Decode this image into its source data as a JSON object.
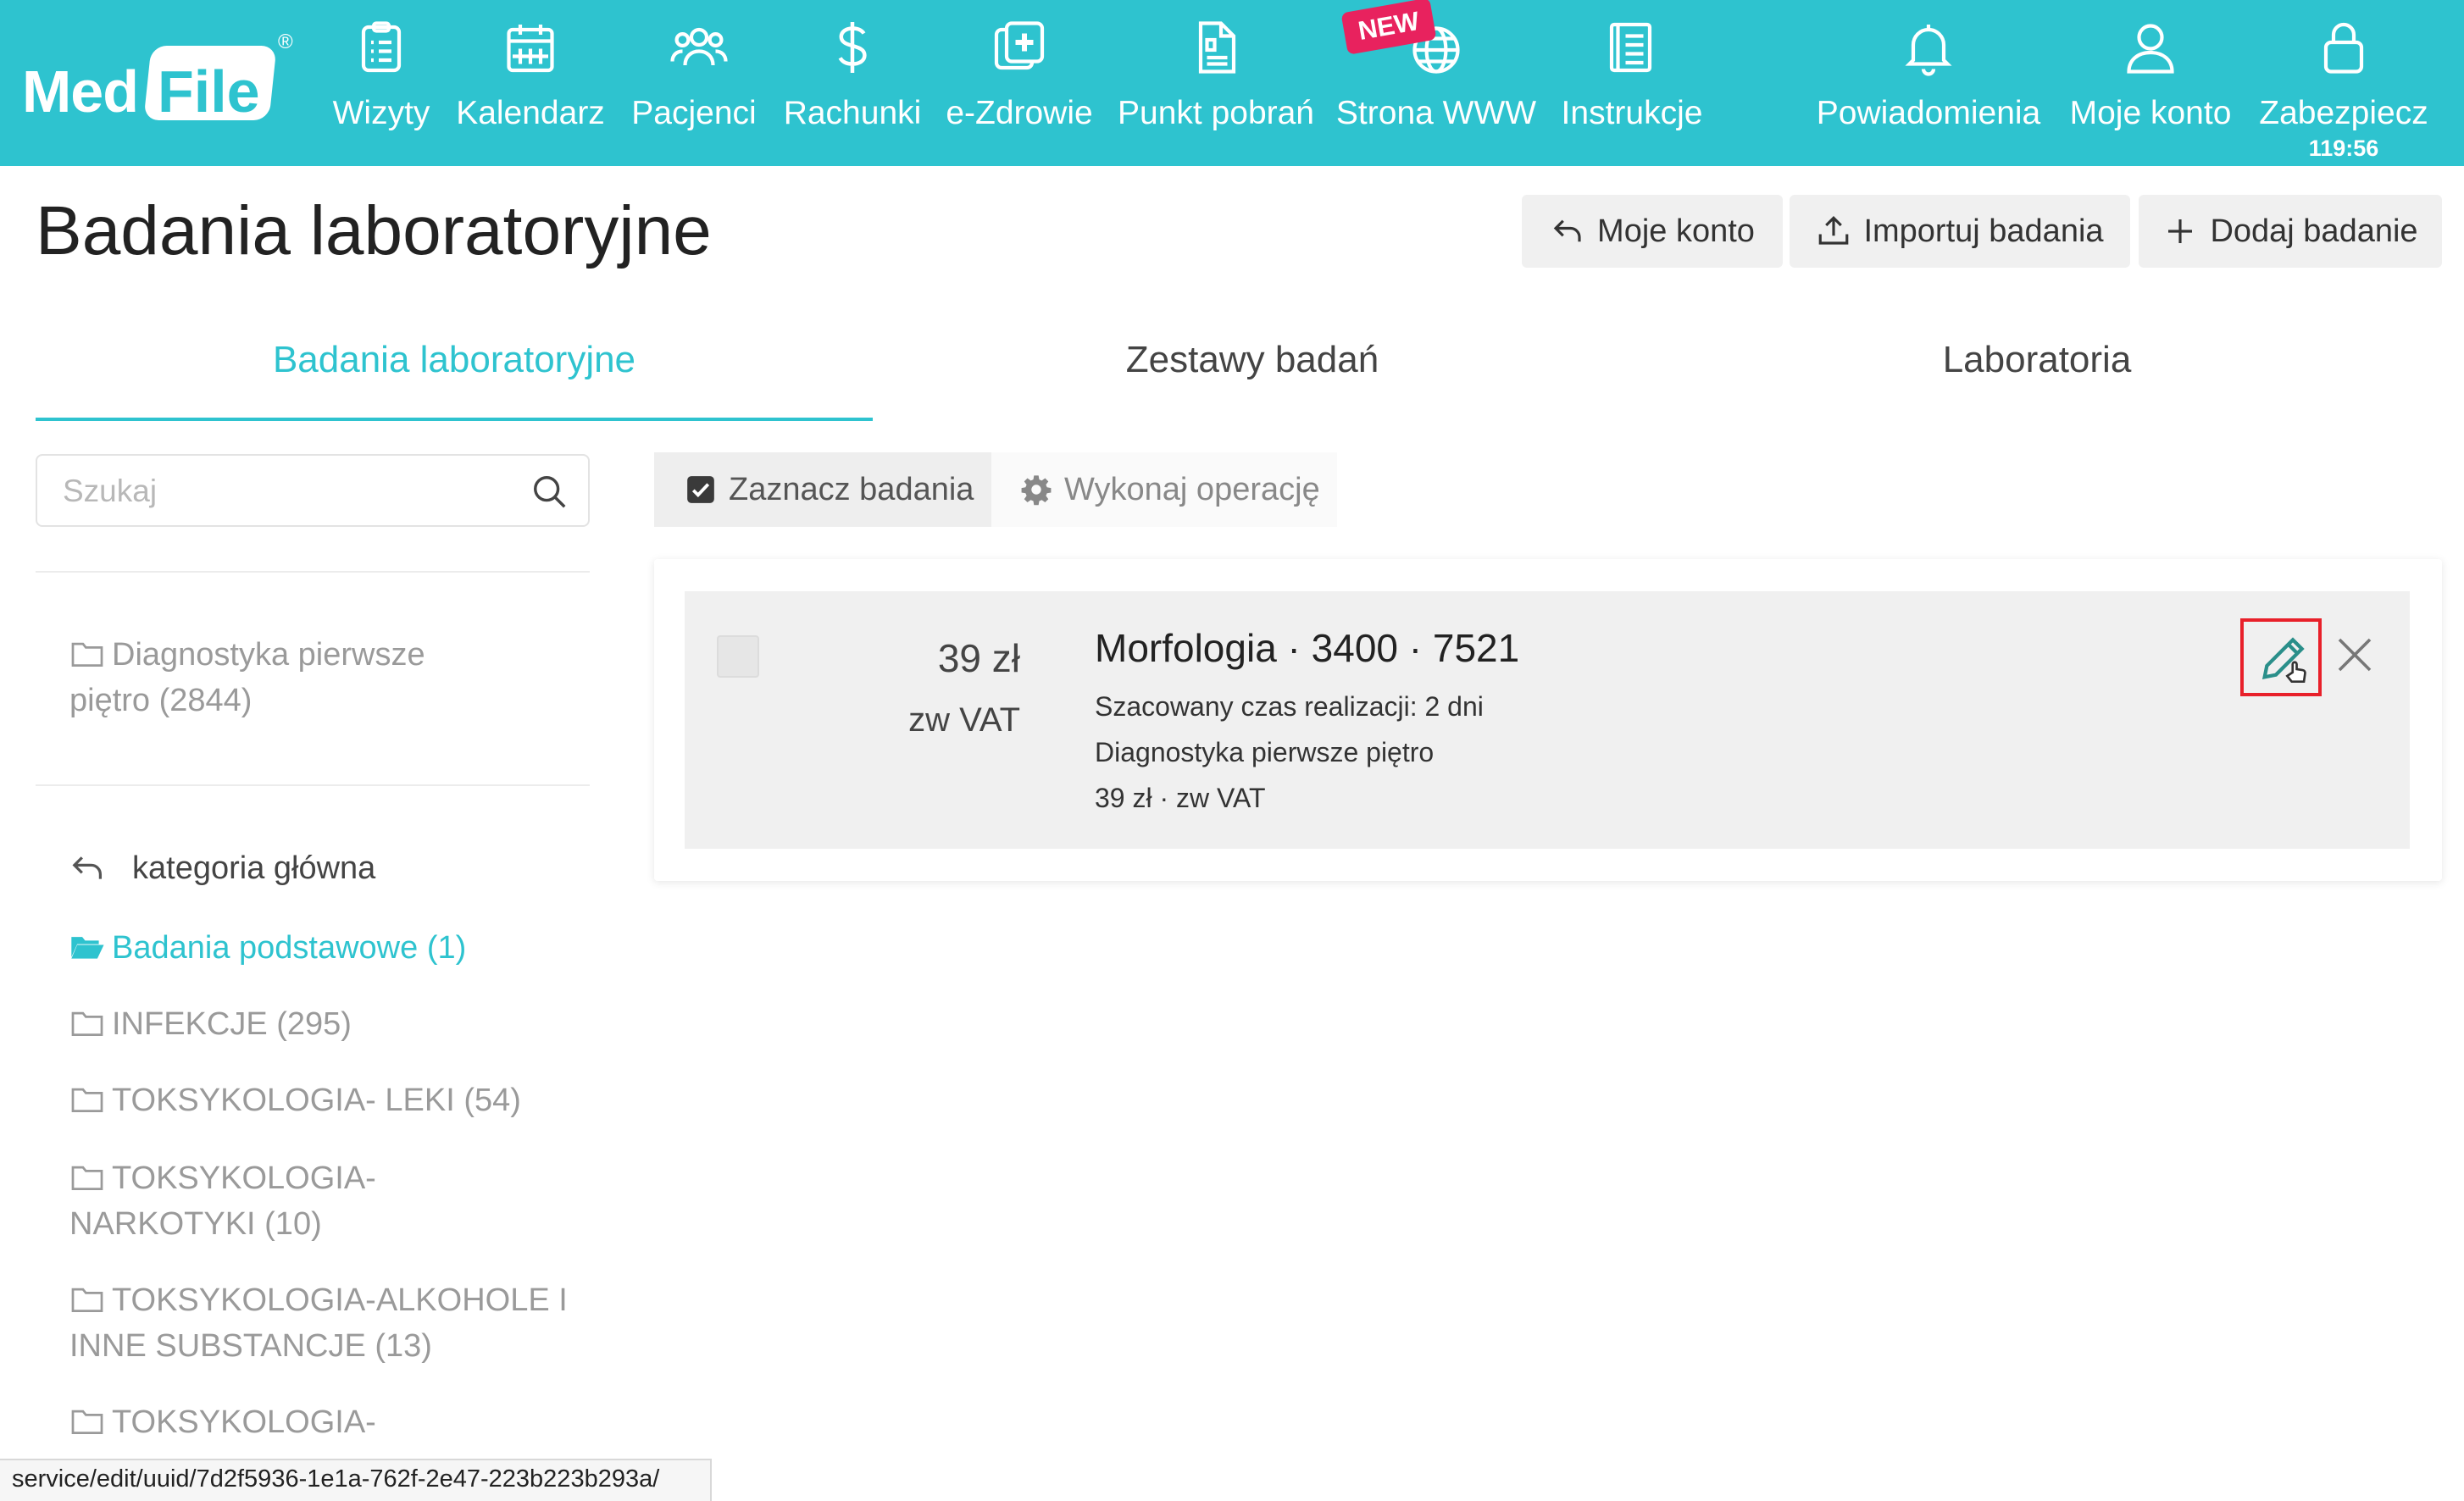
{
  "brand": {
    "logo_med": "Med",
    "logo_file": "File",
    "registered": "®"
  },
  "nav": {
    "items": [
      {
        "label": "Wizyty",
        "icon": "clipboard-icon"
      },
      {
        "label": "Kalendarz",
        "icon": "calendar-icon"
      },
      {
        "label": "Pacjenci",
        "icon": "users-icon"
      },
      {
        "label": "Rachunki",
        "icon": "dollar-icon"
      },
      {
        "label": "e-Zdrowie",
        "icon": "medical-plus-icon"
      },
      {
        "label": "Punkt pobrań",
        "icon": "document-icon"
      },
      {
        "label": "Strona WWW",
        "icon": "globe-icon",
        "badge": "NEW"
      },
      {
        "label": "Instrukcje",
        "icon": "book-icon"
      },
      {
        "label": "Powiadomienia",
        "icon": "bell-icon"
      },
      {
        "label": "Moje konto",
        "icon": "user-icon"
      },
      {
        "label": "Zabezpiecz",
        "icon": "lock-icon",
        "timer": "119:56"
      }
    ]
  },
  "page": {
    "title": "Badania laboratoryjne",
    "buttons": {
      "account": "Moje konto",
      "import": "Importuj badania",
      "add": "Dodaj badanie"
    }
  },
  "tabs": [
    {
      "label": "Badania laboratoryjne",
      "active": true
    },
    {
      "label": "Zestawy badań",
      "active": false
    },
    {
      "label": "Laboratoria",
      "active": false
    }
  ],
  "sidebar": {
    "search_placeholder": "Szukaj",
    "lab_line1": "Diagnostyka pierwsze",
    "lab_line2": "piętro (2844)",
    "back_label": "kategoria główna",
    "categories": [
      {
        "line1": "Badania podstawowe (1)",
        "line2": "",
        "active": true
      },
      {
        "line1": "INFEKCJE (295)",
        "line2": "",
        "active": false
      },
      {
        "line1": "TOKSYKOLOGIA- LEKI (54)",
        "line2": "",
        "active": false
      },
      {
        "line1": "TOKSYKOLOGIA-",
        "line2": "NARKOTYKI (10)",
        "active": false
      },
      {
        "line1": "TOKSYKOLOGIA-ALKOHOLE I",
        "line2": "INNE SUBSTANCJE (13)",
        "active": false
      },
      {
        "line1": "TOKSYKOLOGIA-",
        "line2": "",
        "active": false
      }
    ]
  },
  "toolbar": {
    "select_label": "Zaznacz badania",
    "operation_label": "Wykonaj operację"
  },
  "result": {
    "price": "39 zł",
    "vat": "zw VAT",
    "title": "Morfologia · 3400 · 7521",
    "time": "Szacowany czas realizacji: 2 dni",
    "lab": "Diagnostyka pierwsze piętro",
    "price_line": "39 zł · zw VAT"
  },
  "statusbar": {
    "url": "service/edit/uuid/7d2f5936-1e1a-762f-2e47-223b223b293a/"
  },
  "colors": {
    "accent": "#2ec3cf",
    "badge": "#e8225e",
    "highlight": "#e8202a"
  }
}
